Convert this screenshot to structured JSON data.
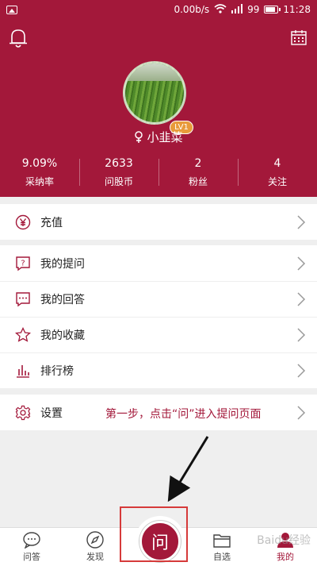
{
  "status_bar": {
    "speed": "0.00b/s",
    "signal": "99",
    "time": "11:28"
  },
  "profile": {
    "name": "小韭菜",
    "level": "LV1"
  },
  "stats": [
    {
      "value": "9.09%",
      "label": "采纳率"
    },
    {
      "value": "2633",
      "label": "问股币"
    },
    {
      "value": "2",
      "label": "粉丝"
    },
    {
      "value": "4",
      "label": "关注"
    }
  ],
  "menu": {
    "recharge": "充值",
    "my_questions": "我的提问",
    "my_answers": "我的回答",
    "my_favorites": "我的收藏",
    "ranking": "排行榜",
    "settings": "设置"
  },
  "annotation": "第一步，点击“问”进入提问页面",
  "tabs": [
    {
      "label": "问答",
      "icon": "chat-icon"
    },
    {
      "label": "发现",
      "icon": "compass-icon"
    },
    {
      "label": "问",
      "icon": "ask-icon"
    },
    {
      "label": "自选",
      "icon": "folder-icon"
    },
    {
      "label": "我的",
      "icon": "profile-icon"
    }
  ],
  "watermark": "Baidu经验",
  "colors": {
    "brand": "#a3183a",
    "annotation_box": "#d63a3a"
  }
}
